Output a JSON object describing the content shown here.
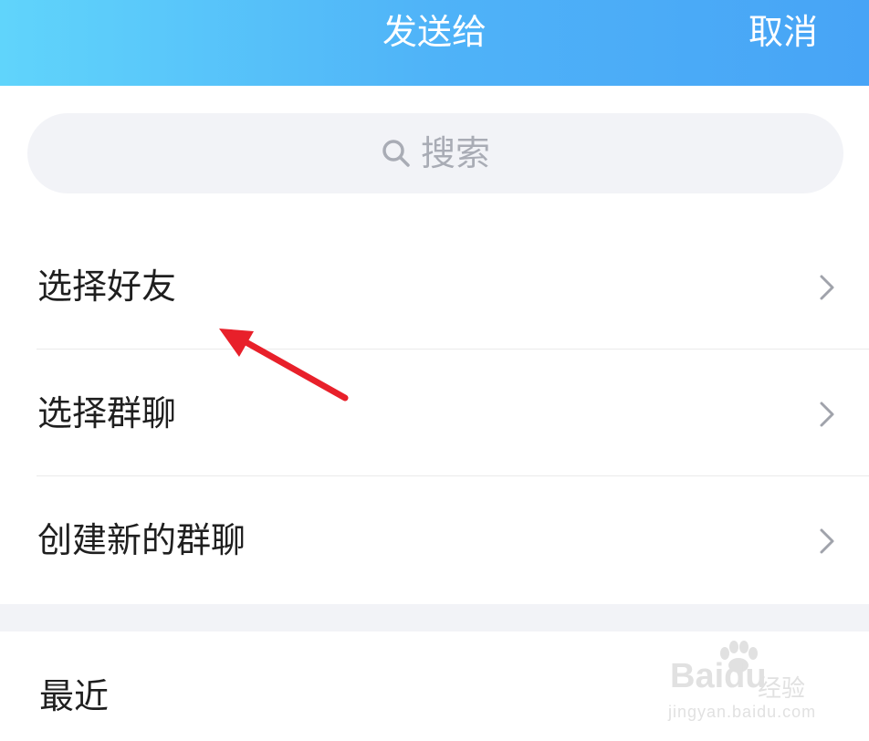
{
  "header": {
    "title": "发送给",
    "cancel_label": "取消",
    "gradient_start": "#60d4fb",
    "gradient_end": "#47a4f6"
  },
  "search": {
    "placeholder": "搜索",
    "icon": "search-icon"
  },
  "menu": {
    "items": [
      {
        "label": "选择好友",
        "icon": "chevron-right-icon"
      },
      {
        "label": "选择群聊",
        "icon": "chevron-right-icon"
      },
      {
        "label": "创建新的群聊",
        "icon": "chevron-right-icon"
      }
    ]
  },
  "recent": {
    "label": "最近"
  },
  "annotation": {
    "arrow_color": "#e8202a"
  },
  "watermark": {
    "brand": "Baidu",
    "suffix": "经验",
    "url": "jingyan.baidu.com"
  }
}
